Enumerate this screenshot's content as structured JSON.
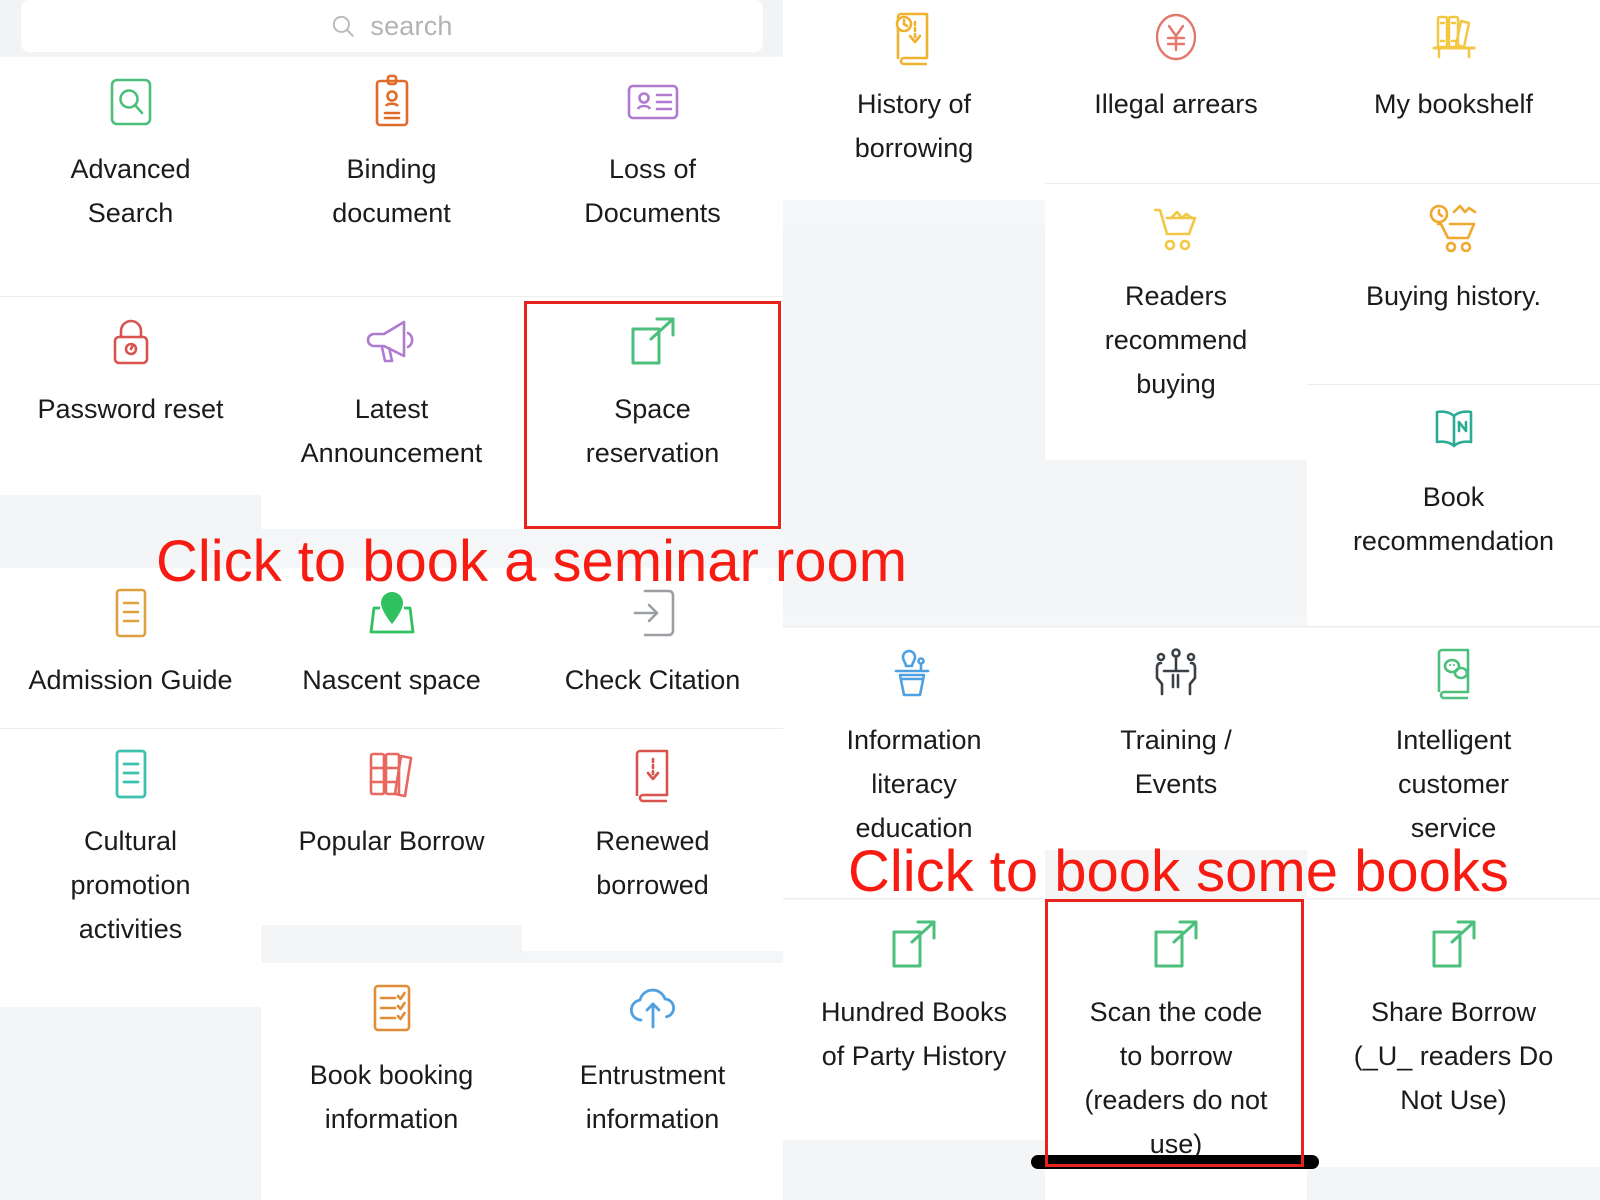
{
  "search": {
    "placeholder": "search",
    "icon": "search-icon"
  },
  "left_panel": {
    "tiles": [
      {
        "label": "Advanced\nSearch",
        "icon": "magnifier-box-icon",
        "color": "#4cbf7c"
      },
      {
        "label": "Binding\ndocument",
        "icon": "id-card-clip-icon",
        "color": "#e06a28"
      },
      {
        "label": "Loss of\nDocuments",
        "icon": "id-badge-icon",
        "color": "#b07ad1"
      },
      {
        "label": "Password reset",
        "icon": "padlock-icon",
        "color": "#d9534f"
      },
      {
        "label": "Latest\nAnnouncement",
        "icon": "megaphone-icon",
        "color": "#b07ad1"
      },
      {
        "label": "Space\nreservation",
        "icon": "external-link-icon",
        "color": "#4cbf7c"
      },
      {
        "label": "Admission Guide",
        "icon": "document-lines-icon",
        "color": "#dfa03f"
      },
      {
        "label": "Nascent space",
        "icon": "map-pin-icon",
        "color": "#2fc060"
      },
      {
        "label": "Check Citation",
        "icon": "arrow-into-box-icon",
        "color": "#9b9fa3"
      },
      {
        "label": "Cultural\npromotion\nactivities",
        "icon": "teal-document-icon",
        "color": "#3ec1ae"
      },
      {
        "label": "Popular Borrow",
        "icon": "books-row-icon",
        "color": "#e8675e"
      },
      {
        "label": "Renewed\nborrowed",
        "icon": "book-down-arrow-icon",
        "color": "#d9534f"
      },
      {
        "label": "Book booking\ninformation",
        "icon": "checklist-icon",
        "color": "#e08c38"
      },
      {
        "label": "Entrustment\ninformation",
        "icon": "cloud-upload-icon",
        "color": "#4ea0e0"
      }
    ]
  },
  "right_panel": {
    "tiles": [
      {
        "label": "History of\nborrowing",
        "icon": "book-clock-down-icon",
        "color": "#efb22e"
      },
      {
        "label": "Illegal arrears",
        "icon": "yen-circle-icon",
        "color": "#e2796f"
      },
      {
        "label": "My bookshelf",
        "icon": "bookshelf-icon",
        "color": "#f2c744"
      },
      {
        "label": "Readers\nrecommend\nbuying",
        "icon": "shopping-cart-icon",
        "color": "#f2c744"
      },
      {
        "label": "Buying history.",
        "icon": "cart-clock-icon",
        "color": "#f0a92e"
      },
      {
        "label": "Book\nrecommendation",
        "icon": "open-book-n-icon",
        "color": "#2aab94"
      },
      {
        "label": "Information\nliteracy\neducation",
        "icon": "lectern-speaker-icon",
        "color": "#4ea0e0"
      },
      {
        "label": "Training /\nEvents",
        "icon": "people-meeting-icon",
        "color": "#3b4046"
      },
      {
        "label": "Intelligent\ncustomer\nservice",
        "icon": "chat-book-icon",
        "color": "#4cbf7c"
      },
      {
        "label": "Hundred Books\nof Party History",
        "icon": "external-link-icon",
        "color": "#4cbf7c"
      },
      {
        "label": "Scan the code\nto borrow\n(readers do not\nuse)",
        "icon": "external-link-icon",
        "color": "#4cbf7c"
      },
      {
        "label": "Share Borrow\n(_U_ readers Do\nNot Use)",
        "icon": "external-link-icon",
        "color": "#4cbf7c"
      }
    ]
  },
  "annotations": [
    {
      "text": "Click to book a seminar room",
      "color": "#f81b11"
    },
    {
      "text": "Click to book some books",
      "color": "#f81b11"
    }
  ],
  "highlights": [
    {
      "target": "Space reservation",
      "color": "#e8231a"
    },
    {
      "target": "Scan the code to borrow (readers do not use)",
      "color": "#e8231a"
    }
  ]
}
